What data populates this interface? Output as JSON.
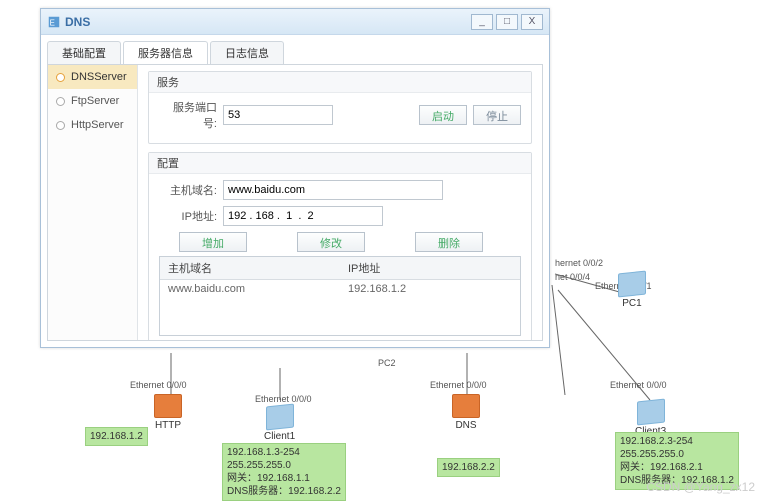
{
  "window": {
    "title": "DNS",
    "tabs": [
      "基础配置",
      "服务器信息",
      "日志信息"
    ],
    "sidebar": [
      {
        "label": "DNSServer"
      },
      {
        "label": "FtpServer"
      },
      {
        "label": "HttpServer"
      }
    ],
    "service": {
      "group_title": "服务",
      "port_label": "服务端口号:",
      "port_value": "53",
      "start": "启动",
      "stop": "停止"
    },
    "config": {
      "group_title": "配置",
      "host_label": "主机域名:",
      "host_value": "www.baidu.com",
      "ip_label": "IP地址:",
      "ip_value": "192 . 168 .  1  .  2",
      "add": "增加",
      "edit": "修改",
      "del": "删除",
      "table_h1": "主机域名",
      "table_h2": "IP地址",
      "rows": [
        {
          "host": "www.baidu.com",
          "ip": "192.168.1.2"
        }
      ]
    }
  },
  "diagram": {
    "labels": {
      "eth_000": "Ethernet 0/0/0",
      "eth_001": "Ethernet 0/0/1",
      "hernet_002": "hernet 0/0/2",
      "net_004": "net 0/0/4",
      "pc2": "PC2"
    },
    "nodes": {
      "http": "HTTP",
      "client1": "Client1",
      "dns": "DNS",
      "client3": "Client3",
      "pc1": "PC1"
    },
    "notes": {
      "n1": "192.168.1.2",
      "n2": "192.168.1.3-254\n255.255.255.0\n网关：192.168.1.1\nDNS服务器：192.168.2.2",
      "n3": "192.168.2.2",
      "n4": "192.168.2.3-254\n255.255.255.0\n网关：192.168.2.1\nDNS服务器：192.168.1.2"
    }
  },
  "watermark": "CSDN @Yang_zx12"
}
